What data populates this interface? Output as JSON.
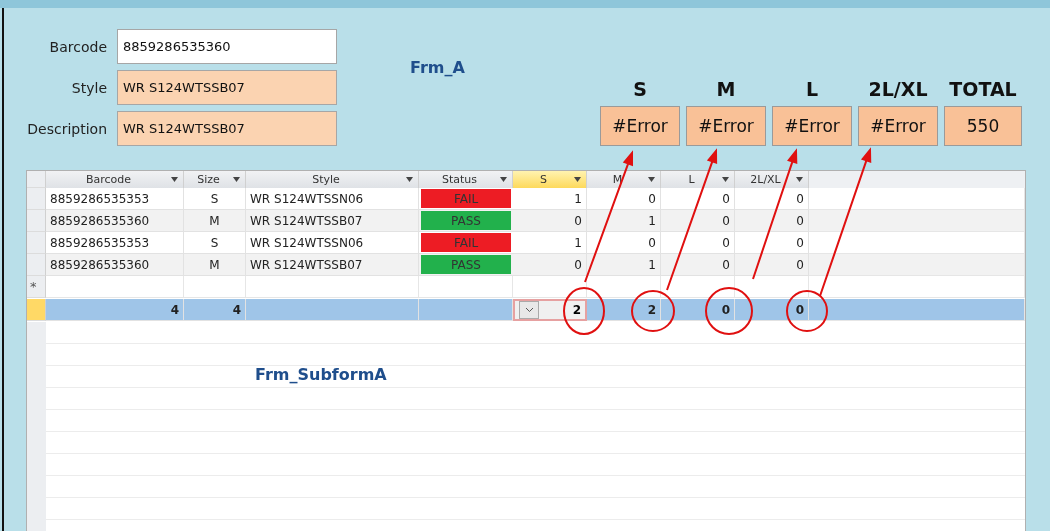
{
  "form": {
    "title": "Frm_A",
    "fields": [
      {
        "label": "Barcode",
        "value": "8859286535360",
        "kind": "input"
      },
      {
        "label": "Style",
        "value": "WR S124WTSSB07",
        "kind": "readonly"
      },
      {
        "label": "Description",
        "value": "WR S124WTSSB07",
        "kind": "readonly"
      }
    ]
  },
  "size_totals": [
    {
      "label": "S",
      "value": "#Error"
    },
    {
      "label": "M",
      "value": "#Error"
    },
    {
      "label": "L",
      "value": "#Error"
    },
    {
      "label": "2L/XL",
      "value": "#Error"
    },
    {
      "label": "TOTAL",
      "value": "550"
    }
  ],
  "subform": {
    "title": "Frm_SubformA",
    "columns": [
      {
        "label": "Barcode",
        "kind": "code",
        "selected": false
      },
      {
        "label": "Size",
        "kind": "center",
        "selected": false
      },
      {
        "label": "Style",
        "kind": "code",
        "selected": false
      },
      {
        "label": "Status",
        "kind": "status",
        "selected": false
      },
      {
        "label": "S",
        "kind": "number",
        "selected": true
      },
      {
        "label": "M",
        "kind": "number",
        "selected": false
      },
      {
        "label": "L",
        "kind": "number",
        "selected": false
      },
      {
        "label": "2L/XL",
        "kind": "number",
        "selected": false
      }
    ],
    "rows": [
      {
        "cells": [
          "8859286535353",
          "S",
          "WR S124WTSSN06",
          {
            "text": "FAIL",
            "color": "#ed1c24"
          },
          "1",
          "0",
          "0",
          "0"
        ],
        "selected": false
      },
      {
        "cells": [
          "8859286535360",
          "M",
          "WR S124WTSSB07",
          {
            "text": "PASS",
            "color": "#22b14c"
          },
          "0",
          "1",
          "0",
          "0"
        ],
        "selected": false
      },
      {
        "cells": [
          "8859286535353",
          "S",
          "WR S124WTSSN06",
          {
            "text": "FAIL",
            "color": "#ed1c24"
          },
          "1",
          "0",
          "0",
          "0"
        ],
        "selected": false
      },
      {
        "cells": [
          "8859286535360",
          "M",
          "WR S124WTSSB07",
          {
            "text": "PASS",
            "color": "#22b14c"
          },
          "0",
          "1",
          "0",
          "0"
        ],
        "selected": false
      }
    ],
    "new_row_marker": "*",
    "totals": {
      "selected": true,
      "cells": [
        {
          "value": "4",
          "focused": false
        },
        {
          "value": "4",
          "focused": false
        },
        {
          "focused": false
        },
        {
          "focused": false
        },
        {
          "value": "2",
          "focused": true
        },
        {
          "value": "2",
          "focused": false
        },
        {
          "value": "0",
          "focused": false
        },
        {
          "value": "0",
          "focused": false
        }
      ]
    }
  }
}
